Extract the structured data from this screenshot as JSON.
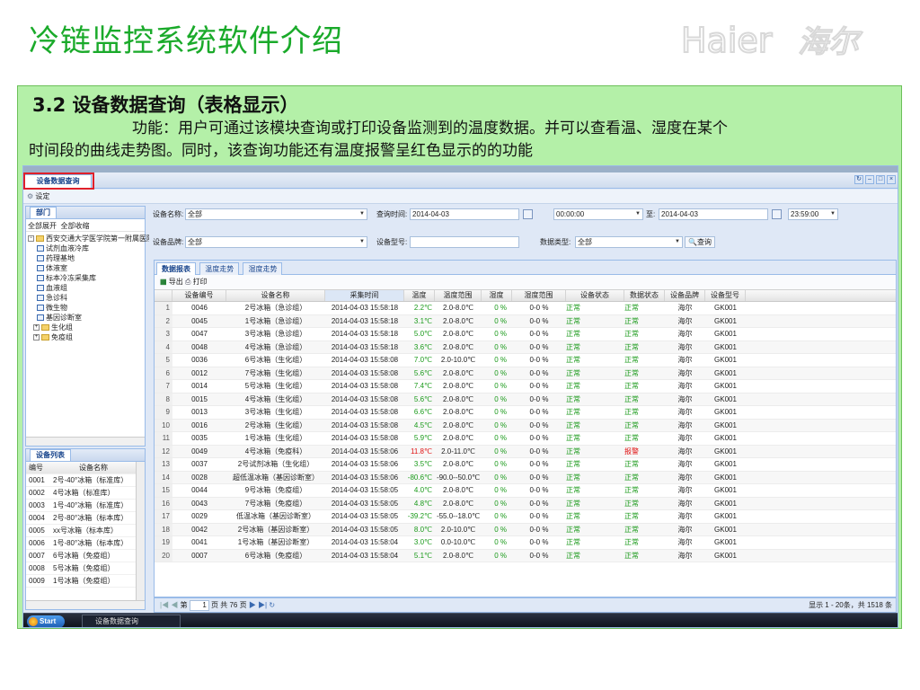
{
  "slide": {
    "title": "冷链监控系统软件介绍",
    "logo_text": "Haier海尔",
    "heading": "3.2  设备数据查询（表格显示）",
    "desc_line1": "功能：用户可通过该模块查询或打印设备监测到的温度数据。并可以查看温、湿度在某个",
    "desc_line2": "时间段的曲线走势图。同时，该查询功能还有温度报警呈红色显示的的功能"
  },
  "window": {
    "tab_label": "设备数据查询",
    "toolbar_settings": "设定"
  },
  "dept_panel": {
    "title": "部门",
    "expand_all": "全部展开",
    "collapse_all": "全部收缩",
    "root": "西安交通大学医学院第一附属医院",
    "items": [
      "试剂血液冷库",
      "药理基地",
      "体液室",
      "标本冷冻采集库",
      "血液组",
      "急诊科",
      "微生物",
      "基因诊断室"
    ],
    "folders": [
      "生化组",
      "免疫组"
    ]
  },
  "device_panel": {
    "title": "设备列表",
    "col_id": "编号",
    "col_name": "设备名称",
    "rows": [
      {
        "id": "0001",
        "name": "2号-40°冰箱（标准库）"
      },
      {
        "id": "0002",
        "name": "4号冰箱（标准库）"
      },
      {
        "id": "0003",
        "name": "1号-40°冰箱（标准库）"
      },
      {
        "id": "0004",
        "name": "2号-80°冰箱（标本库）"
      },
      {
        "id": "0005",
        "name": "xx号冰箱（标本库）"
      },
      {
        "id": "0006",
        "name": "1号-80°冰箱（标本库）"
      },
      {
        "id": "0007",
        "name": "6号冰箱（免疫组）"
      },
      {
        "id": "0008",
        "name": "5号冰箱（免疫组）"
      },
      {
        "id": "0009",
        "name": "1号冰箱（免疫组）"
      }
    ]
  },
  "filters": {
    "name_label": "设备名称:",
    "name_value": "全部",
    "time_label": "查询时间:",
    "date_from": "2014-04-03",
    "time_from": "00:00:00",
    "to_label": "至:",
    "date_to": "2014-04-03",
    "time_to": "23:59:00",
    "brand_label": "设备品牌:",
    "brand_value": "全部",
    "model_label": "设备型号:",
    "model_value": "",
    "datatype_label": "数据类型:",
    "datatype_value": "全部",
    "query_button": "查询"
  },
  "grid": {
    "tabs": [
      "数据报表",
      "温度走势",
      "湿度走势"
    ],
    "export_label": "导出",
    "print_label": "打印",
    "columns": [
      "",
      "设备编号",
      "设备名称",
      "采集时间",
      "温度",
      "温度范围",
      "湿度",
      "湿度范围",
      "设备状态",
      "数据状态",
      "设备品牌",
      "设备型号"
    ],
    "rows": [
      [
        "1",
        "0046",
        "2号冰箱（急诊组）",
        "2014-04-03 15:58:18",
        "2.2℃",
        "2.0-8.0℃",
        "0 %",
        "0-0 %",
        "正常",
        "正常",
        "海尔",
        "GK001"
      ],
      [
        "2",
        "0045",
        "1号冰箱（急诊组）",
        "2014-04-03 15:58:18",
        "3.1℃",
        "2.0-8.0℃",
        "0 %",
        "0-0 %",
        "正常",
        "正常",
        "海尔",
        "GK001"
      ],
      [
        "3",
        "0047",
        "3号冰箱（急诊组）",
        "2014-04-03 15:58:18",
        "5.0℃",
        "2.0-8.0℃",
        "0 %",
        "0-0 %",
        "正常",
        "正常",
        "海尔",
        "GK001"
      ],
      [
        "4",
        "0048",
        "4号冰箱（急诊组）",
        "2014-04-03 15:58:18",
        "3.6℃",
        "2.0-8.0℃",
        "0 %",
        "0-0 %",
        "正常",
        "正常",
        "海尔",
        "GK001"
      ],
      [
        "5",
        "0036",
        "6号冰箱（生化组）",
        "2014-04-03 15:58:08",
        "7.0℃",
        "2.0-10.0℃",
        "0 %",
        "0-0 %",
        "正常",
        "正常",
        "海尔",
        "GK001"
      ],
      [
        "6",
        "0012",
        "7号冰箱（生化组）",
        "2014-04-03 15:58:08",
        "5.6℃",
        "2.0-8.0℃",
        "0 %",
        "0-0 %",
        "正常",
        "正常",
        "海尔",
        "GK001"
      ],
      [
        "7",
        "0014",
        "5号冰箱（生化组）",
        "2014-04-03 15:58:08",
        "7.4℃",
        "2.0-8.0℃",
        "0 %",
        "0-0 %",
        "正常",
        "正常",
        "海尔",
        "GK001"
      ],
      [
        "8",
        "0015",
        "4号冰箱（生化组）",
        "2014-04-03 15:58:08",
        "5.6℃",
        "2.0-8.0℃",
        "0 %",
        "0-0 %",
        "正常",
        "正常",
        "海尔",
        "GK001"
      ],
      [
        "9",
        "0013",
        "3号冰箱（生化组）",
        "2014-04-03 15:58:08",
        "6.6℃",
        "2.0-8.0℃",
        "0 %",
        "0-0 %",
        "正常",
        "正常",
        "海尔",
        "GK001"
      ],
      [
        "10",
        "0016",
        "2号冰箱（生化组）",
        "2014-04-03 15:58:08",
        "4.5℃",
        "2.0-8.0℃",
        "0 %",
        "0-0 %",
        "正常",
        "正常",
        "海尔",
        "GK001"
      ],
      [
        "11",
        "0035",
        "1号冰箱（生化组）",
        "2014-04-03 15:58:08",
        "5.9℃",
        "2.0-8.0℃",
        "0 %",
        "0-0 %",
        "正常",
        "正常",
        "海尔",
        "GK001"
      ],
      [
        "12",
        "0049",
        "4号冰箱（免疫科）",
        "2014-04-03 15:58:06",
        "11.8℃",
        "2.0-11.0℃",
        "0 %",
        "0-0 %",
        "正常",
        "报警",
        "海尔",
        "GK001"
      ],
      [
        "13",
        "0037",
        "2号试剂冰箱（生化组）",
        "2014-04-03 15:58:06",
        "3.5℃",
        "2.0-8.0℃",
        "0 %",
        "0-0 %",
        "正常",
        "正常",
        "海尔",
        "GK001"
      ],
      [
        "14",
        "0028",
        "超低温冰箱（基因诊断室）",
        "2014-04-03 15:58:06",
        "-80.6℃",
        "-90.0--50.0℃",
        "0 %",
        "0-0 %",
        "正常",
        "正常",
        "海尔",
        "GK001"
      ],
      [
        "15",
        "0044",
        "9号冰箱（免疫组）",
        "2014-04-03 15:58:05",
        "4.0℃",
        "2.0-8.0℃",
        "0 %",
        "0-0 %",
        "正常",
        "正常",
        "海尔",
        "GK001"
      ],
      [
        "16",
        "0043",
        "7号冰箱（免疫组）",
        "2014-04-03 15:58:05",
        "4.8℃",
        "2.0-8.0℃",
        "0 %",
        "0-0 %",
        "正常",
        "正常",
        "海尔",
        "GK001"
      ],
      [
        "17",
        "0029",
        "低温冰箱（基因诊断室）",
        "2014-04-03 15:58:05",
        "-39.2℃",
        "-55.0--18.0℃",
        "0 %",
        "0-0 %",
        "正常",
        "正常",
        "海尔",
        "GK001"
      ],
      [
        "18",
        "0042",
        "2号冰箱（基因诊断室）",
        "2014-04-03 15:58:05",
        "8.0℃",
        "2.0-10.0℃",
        "0 %",
        "0-0 %",
        "正常",
        "正常",
        "海尔",
        "GK001"
      ],
      [
        "19",
        "0041",
        "1号冰箱（基因诊断室）",
        "2014-04-03 15:58:04",
        "3.0℃",
        "0.0-10.0℃",
        "0 %",
        "0-0 %",
        "正常",
        "正常",
        "海尔",
        "GK001"
      ],
      [
        "20",
        "0007",
        "6号冰箱（免疫组）",
        "2014-04-03 15:58:04",
        "5.1℃",
        "2.0-8.0℃",
        "0 %",
        "0-0 %",
        "正常",
        "正常",
        "海尔",
        "GK001"
      ]
    ]
  },
  "pager": {
    "page_prefix": "第",
    "page_value": "1",
    "page_suffix": "页 共 76 页",
    "summary": "显示 1 - 20条，共 1518 条"
  },
  "taskbar": {
    "start": "Start",
    "task": "设备数据查询"
  },
  "colors": {
    "title_green": "#1aaa2a",
    "box_green": "#b4f0a8",
    "ok_green": "#1a9a1a",
    "alarm_red": "#e01010"
  }
}
